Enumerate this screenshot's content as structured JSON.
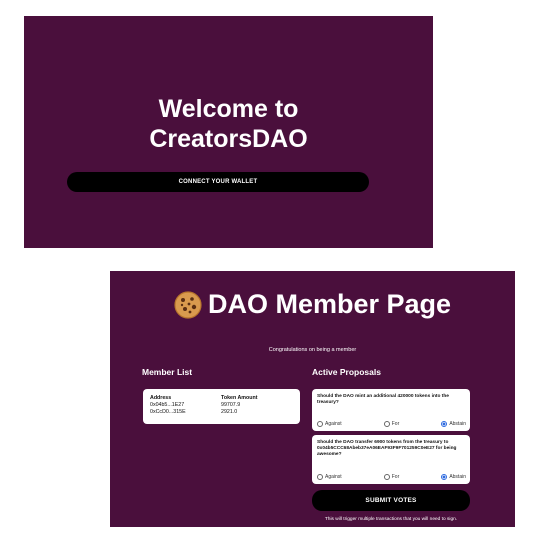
{
  "welcome": {
    "title_line1": "Welcome to",
    "title_line2": "CreatorsDAO",
    "connect_label": "CONNECT YOUR WALLET"
  },
  "member_page": {
    "title": "DAO Member Page",
    "icon": "cookie-icon",
    "congrats": "Congratulations on being a member",
    "member_list": {
      "heading": "Member List",
      "columns": [
        "Address",
        "Token Amount"
      ],
      "rows": [
        {
          "address": "0x04b5...1E27",
          "amount": "99707.9"
        },
        {
          "address": "0xCcD0...315E",
          "amount": "2921.0"
        }
      ]
    },
    "proposals": {
      "heading": "Active Proposals",
      "items": [
        {
          "question": "Should the DAO mint an additional 420000 tokens into the treasury?",
          "options": [
            "Against",
            "For",
            "Abstain"
          ],
          "selected": "Abstain"
        },
        {
          "question": "Should the DAO transfer 6900 tokens from the treasury to 0x04b5CCC68Abeb37eA06EAF93F9F701259C0eE27 for being awesome?",
          "options": [
            "Against",
            "For",
            "Abstain"
          ],
          "selected": "Abstain"
        }
      ]
    },
    "submit_label": "SUBMIT VOTES",
    "note": "This will trigger multiple transactions that you will need to sign."
  },
  "colors": {
    "panel_bg": "#4a0f3c",
    "button_bg": "#000000",
    "radio_selected": "#2d6ae0"
  }
}
